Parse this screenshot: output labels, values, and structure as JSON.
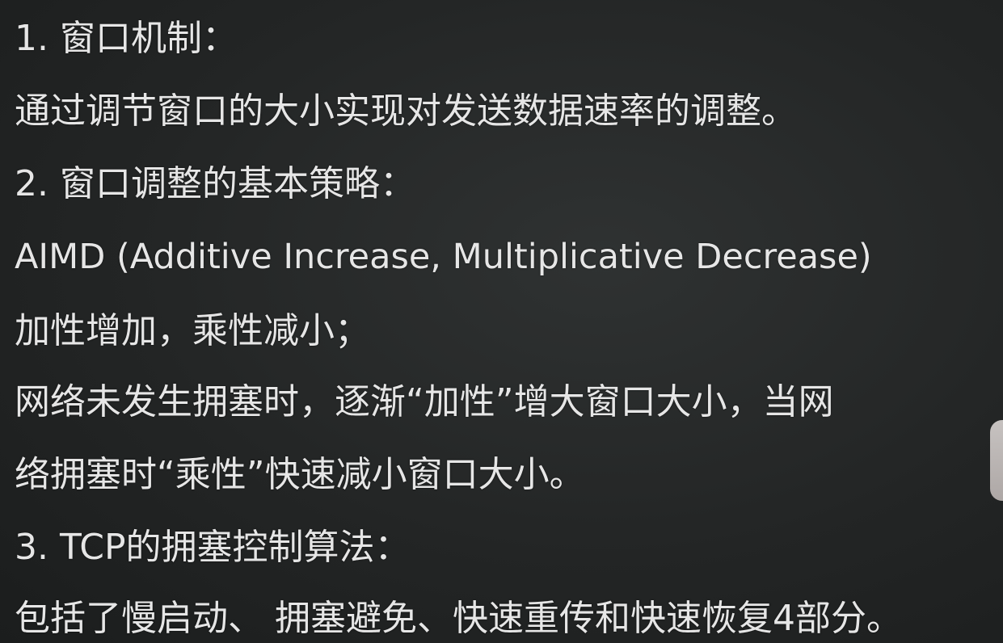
{
  "slide": {
    "lines": [
      "1. 窗口机制：",
      "通过调节窗口的大小实现对发送数据速率的调整。",
      "2. 窗口调整的基本策略：",
      "AIMD (Additive Increase, Multiplicative Decrease)",
      "加性增加，乘性减小；",
      "网络未发生拥塞时，逐渐“加性”增大窗口大小，当网",
      "络拥塞时“乘性”快速减小窗口大小。",
      "3. TCP的拥塞控制算法：",
      "包括了慢启动、 拥塞避免、快速重传和快速恢复4部分。"
    ]
  },
  "colors": {
    "background": "#252727",
    "text": "#e6e6e6"
  }
}
